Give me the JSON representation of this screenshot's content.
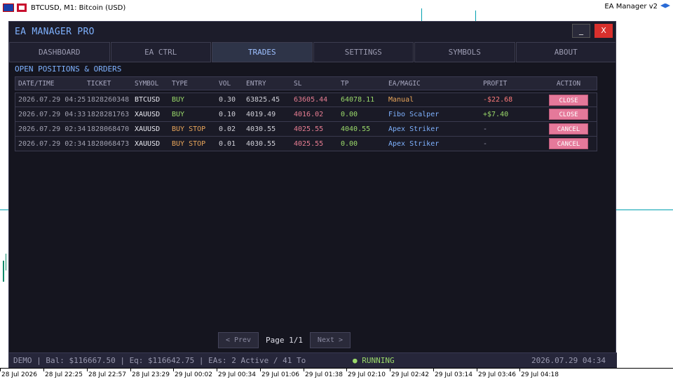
{
  "chart_window": {
    "title": "BTCUSD, M1:  Bitcoin (USD)",
    "ea_label": "EA Manager v2"
  },
  "time_axis": [
    "28 Jul 2026",
    "28 Jul 22:25",
    "28 Jul 22:57",
    "28 Jul 23:29",
    "29 Jul 00:02",
    "29 Jul 00:34",
    "29 Jul 01:06",
    "29 Jul 01:38",
    "29 Jul 02:10",
    "29 Jul 02:42",
    "29 Jul 03:14",
    "29 Jul 03:46",
    "29 Jul 04:18"
  ],
  "panel": {
    "title": "EA MANAGER PRO",
    "minimize_label": "_",
    "close_label": "X",
    "tabs": [
      "DASHBOARD",
      "EA CTRL",
      "TRADES",
      "SETTINGS",
      "SYMBOLS",
      "ABOUT"
    ],
    "active_tab": "TRADES",
    "section_title": "OPEN POSITIONS & ORDERS",
    "columns": [
      "DATE/TIME",
      "TICKET",
      "SYMBOL",
      "TYPE",
      "VOL",
      "ENTRY",
      "SL",
      "TP",
      "EA/MAGIC",
      "PROFIT",
      "ACTION"
    ],
    "rows": [
      {
        "datetime": "2026.07.29 04:25",
        "ticket": "1828260348",
        "symbol": "BTCUSD",
        "type": "BUY",
        "vol": "0.30",
        "entry": "63825.45",
        "sl": "63605.44",
        "tp": "64078.11",
        "ea": "Manual",
        "profit": "-$22.68",
        "action": "CLOSE"
      },
      {
        "datetime": "2026.07.29 04:33",
        "ticket": "1828281763",
        "symbol": "XAUUSD",
        "type": "BUY",
        "vol": "0.10",
        "entry": "4019.49",
        "sl": "4016.02",
        "tp": "0.00",
        "ea": "Fibo Scalper",
        "profit": "+$7.40",
        "action": "CLOSE"
      },
      {
        "datetime": "2026.07.29 02:34",
        "ticket": "1828068470",
        "symbol": "XAUUSD",
        "type": "BUY STOP",
        "vol": "0.02",
        "entry": "4030.55",
        "sl": "4025.55",
        "tp": "4040.55",
        "ea": "Apex Striker",
        "profit": "-",
        "action": "CANCEL"
      },
      {
        "datetime": "2026.07.29 02:34",
        "ticket": "1828068473",
        "symbol": "XAUUSD",
        "type": "BUY STOP",
        "vol": "0.01",
        "entry": "4030.55",
        "sl": "4025.55",
        "tp": "0.00",
        "ea": "Apex Striker",
        "profit": "-",
        "action": "CANCEL"
      }
    ],
    "pager": {
      "prev": "< Prev",
      "page": "Page 1/1",
      "next": "Next >"
    },
    "status": {
      "left": "DEMO | Bal: $116667.50 | Eq: $116642.75 | EAs: 2 Active / 41 To",
      "running": "● RUNNING",
      "clock": "2026.07.29 04:34"
    }
  }
}
